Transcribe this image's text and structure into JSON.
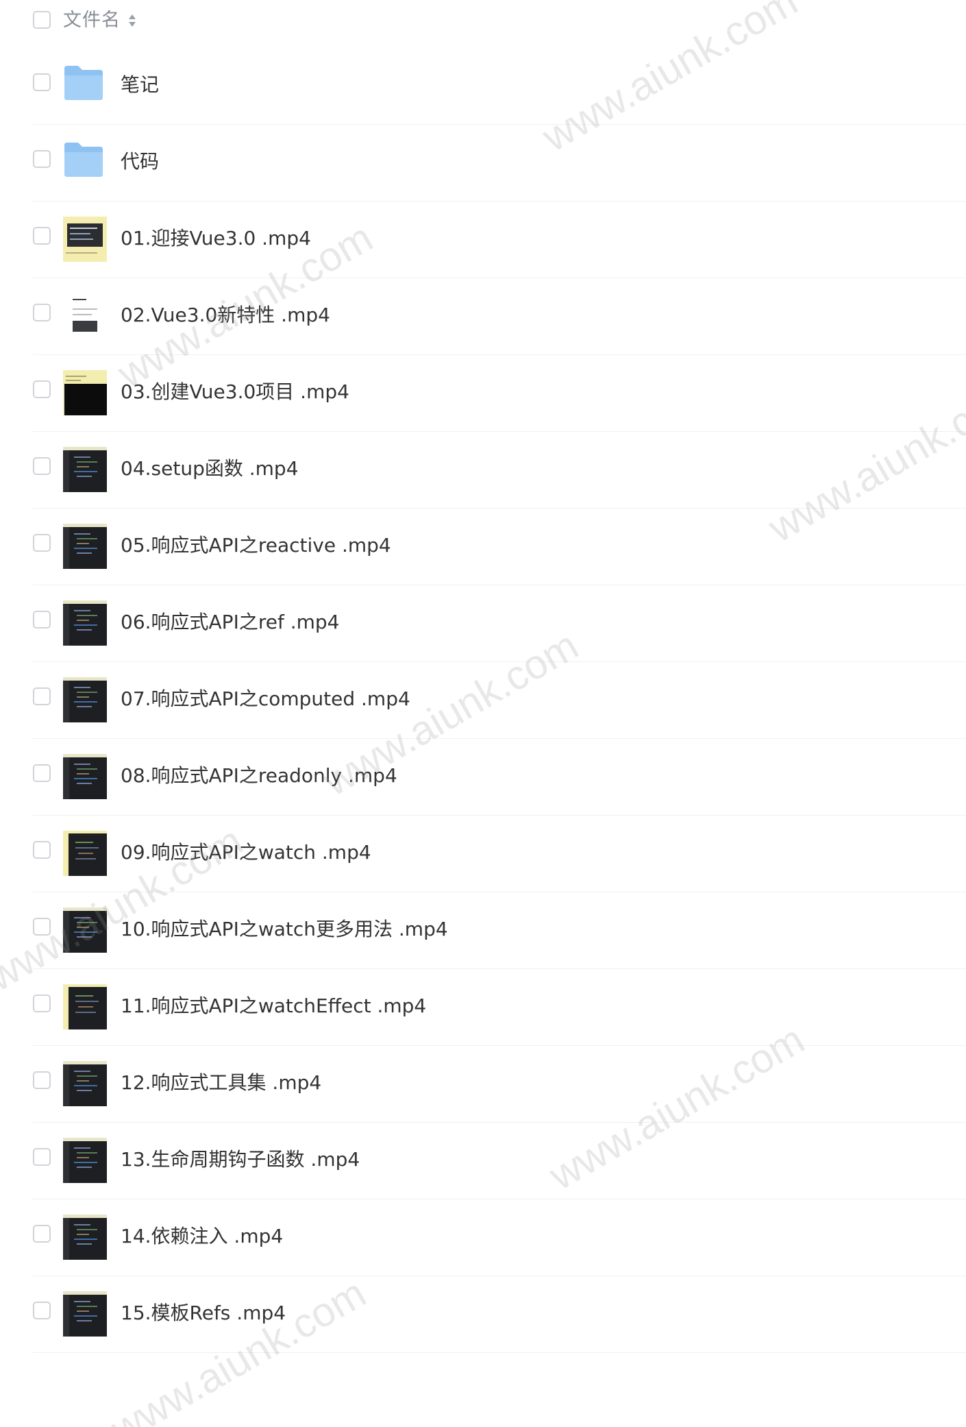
{
  "header": {
    "column_label": "文件名"
  },
  "files": [
    {
      "name": "笔记",
      "type": "folder"
    },
    {
      "name": "代码",
      "type": "folder"
    },
    {
      "name": "01.迎接Vue3.0 .mp4",
      "type": "video",
      "thumb": "yellow-slide"
    },
    {
      "name": "02.Vue3.0新特性 .mp4",
      "type": "video",
      "thumb": "white-doc"
    },
    {
      "name": "03.创建Vue3.0项目 .mp4",
      "type": "video",
      "thumb": "yellow-terminal"
    },
    {
      "name": "04.setup函数 .mp4",
      "type": "video",
      "thumb": "dark-code"
    },
    {
      "name": "05.响应式API之reactive .mp4",
      "type": "video",
      "thumb": "dark-code"
    },
    {
      "name": "06.响应式API之ref .mp4",
      "type": "video",
      "thumb": "dark-code"
    },
    {
      "name": "07.响应式API之computed .mp4",
      "type": "video",
      "thumb": "dark-code"
    },
    {
      "name": "08.响应式API之readonly .mp4",
      "type": "video",
      "thumb": "dark-code"
    },
    {
      "name": "09.响应式API之watch .mp4",
      "type": "video",
      "thumb": "yellow-code"
    },
    {
      "name": "10.响应式API之watch更多用法 .mp4",
      "type": "video",
      "thumb": "dark-code"
    },
    {
      "name": "11.响应式API之watchEffect .mp4",
      "type": "video",
      "thumb": "yellow-code"
    },
    {
      "name": "12.响应式工具集 .mp4",
      "type": "video",
      "thumb": "dark-code"
    },
    {
      "name": "13.生命周期钩子函数 .mp4",
      "type": "video",
      "thumb": "dark-code"
    },
    {
      "name": "14.依赖注入 .mp4",
      "type": "video",
      "thumb": "dark-code"
    },
    {
      "name": "15.模板Refs .mp4",
      "type": "video",
      "thumb": "dark-code"
    }
  ],
  "watermarks": [
    "www.aiunk.com",
    "www.aiunk.com",
    "www.aiunk.com",
    "www.aiunk.com",
    "www.aiunk.com",
    "www.aiunk.com",
    "www.aiunk.com"
  ],
  "colors": {
    "folder": "#8ec2f2",
    "checkbox_border": "#d0d3d8",
    "divider": "#eef0f3",
    "header_text": "#888e96"
  }
}
